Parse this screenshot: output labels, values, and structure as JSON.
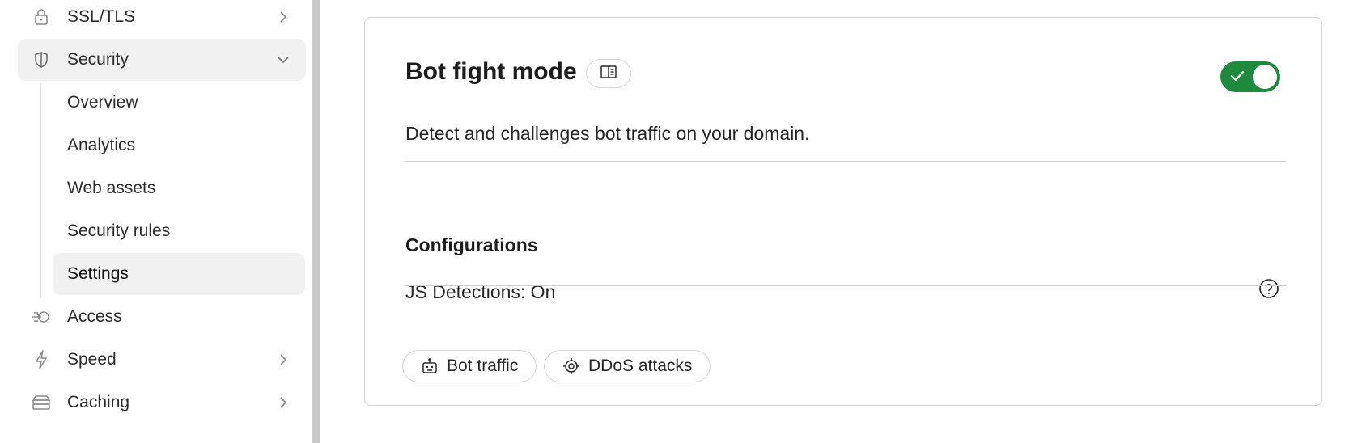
{
  "sidebar": {
    "items": [
      {
        "label": "SSL/TLS",
        "icon": "lock-icon",
        "chevron": "right"
      },
      {
        "label": "Security",
        "icon": "shield-icon",
        "chevron": "down",
        "active": true
      },
      {
        "label": "Access",
        "icon": "access-icon"
      },
      {
        "label": "Speed",
        "icon": "lightning-icon",
        "chevron": "right"
      },
      {
        "label": "Caching",
        "icon": "caching-icon",
        "chevron": "right"
      }
    ],
    "security_subitems": [
      {
        "label": "Overview"
      },
      {
        "label": "Analytics"
      },
      {
        "label": "Web assets"
      },
      {
        "label": "Security rules"
      },
      {
        "label": "Settings",
        "active": true
      }
    ]
  },
  "card": {
    "title": "Bot fight mode",
    "docs_icon": "book-icon",
    "toggle": {
      "state": "on",
      "color": "#1e8a3e"
    },
    "description": "Detect and challenges bot traffic on your domain.",
    "configurations_title": "Configurations",
    "js_detections": "JS Detections: On",
    "help_icon": "question-circle-icon",
    "chips": [
      {
        "label": "Bot traffic",
        "icon": "robot-icon"
      },
      {
        "label": "DDoS attacks",
        "icon": "target-icon"
      }
    ]
  },
  "colors": {
    "accent_green": "#1e8a3e",
    "active_bg": "#f1f1f1",
    "divider": "#c8c8c8"
  }
}
